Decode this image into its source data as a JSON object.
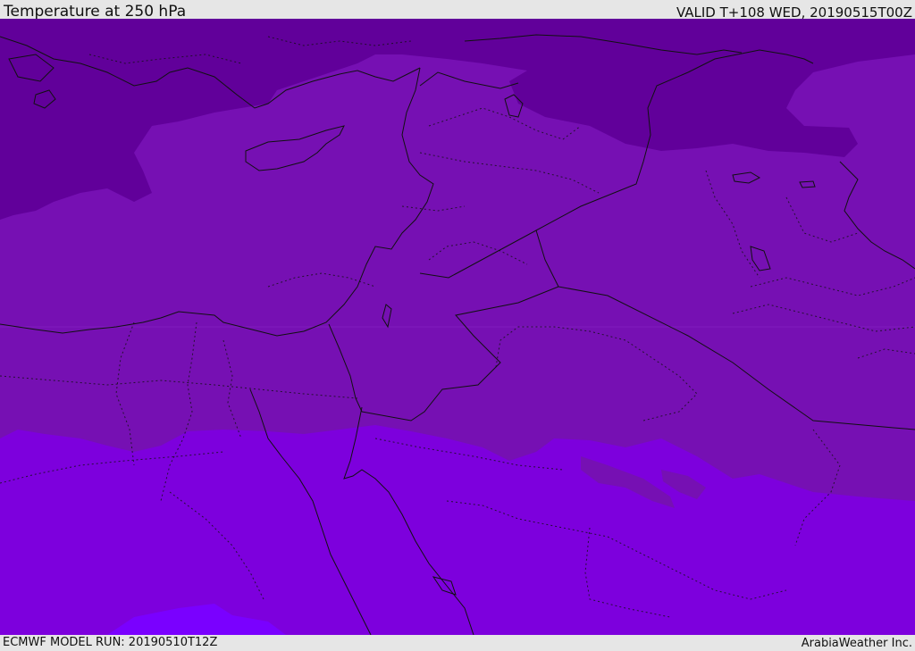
{
  "header": {
    "title": "Temperature at 250 hPa",
    "valid": "VALID T+108 WED, 20190515T00Z"
  },
  "footer": {
    "model_run": "ECMWF MODEL RUN: 20190510T12Z",
    "credit": "ArabiaWeather Inc."
  },
  "map": {
    "region": "Eastern Mediterranean, Egypt, Levant, Iraq and northern Arabia",
    "field": "250 hPa temperature shading",
    "colors": {
      "coldest": "#61009a",
      "cold": "#7610b3",
      "mild": "#7d00dd",
      "warm": "#7a00ff",
      "border": "#111111"
    }
  }
}
